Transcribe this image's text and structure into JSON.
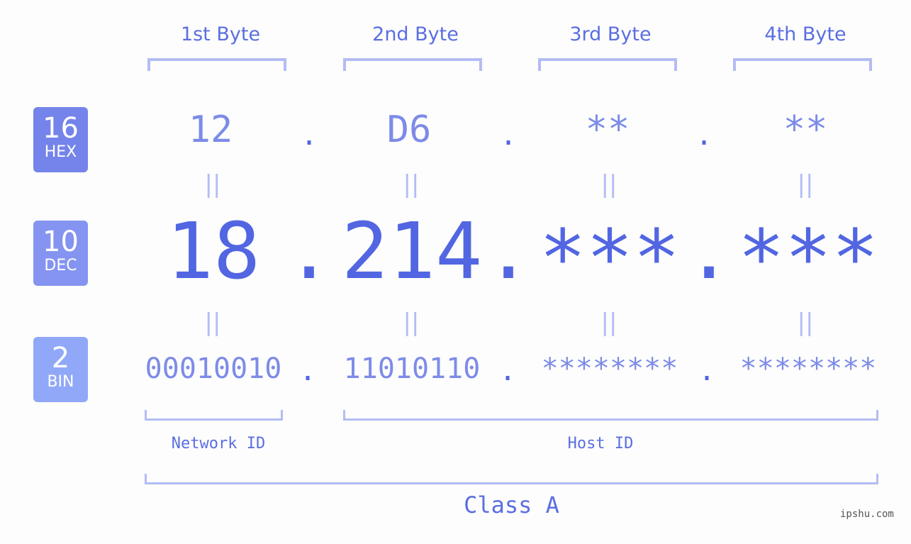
{
  "headers": [
    "1st Byte",
    "2nd Byte",
    "3rd Byte",
    "4th Byte"
  ],
  "badges": [
    {
      "num": "16",
      "label": "HEX",
      "color": "#7584ea"
    },
    {
      "num": "10",
      "label": "DEC",
      "color": "#8494f0"
    },
    {
      "num": "2",
      "label": "BIN",
      "color": "#91a8f8"
    }
  ],
  "hex": [
    "12",
    "D6",
    "**",
    "**"
  ],
  "dec": [
    "18",
    "214",
    "***",
    "***"
  ],
  "bin": [
    "00010010",
    "11010110",
    "********",
    "********"
  ],
  "separator": ".",
  "equals": "||",
  "labels": {
    "network": "Network ID",
    "host": "Host ID",
    "class": "Class A"
  },
  "watermark": "ipshu.com"
}
